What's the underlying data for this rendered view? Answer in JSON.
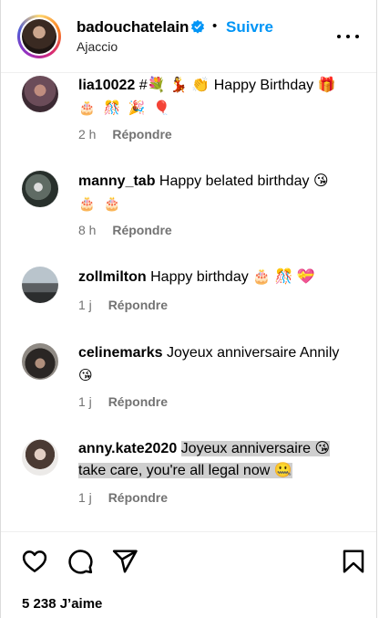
{
  "header": {
    "username": "badouchatelain",
    "follow_label": "Suivre",
    "separator": "•",
    "location": "Ajaccio",
    "verified_icon": "verified-badge-icon",
    "more_icon": "more-options-icon"
  },
  "comments": [
    {
      "username": "lia10022",
      "text": "#💐 💃 👏 Happy Birthday 🎁",
      "emoji_line": "🎂 🎊 🎉 🎈",
      "time": "2 h",
      "reply_label": "Répondre",
      "highlighted": false
    },
    {
      "username": "manny_tab",
      "text": "Happy belated birthday 😘",
      "emoji_line": "🎂 🎂",
      "time": "8 h",
      "reply_label": "Répondre",
      "highlighted": false
    },
    {
      "username": "zollmilton",
      "text": "Happy birthday 🎂 🎊 💝",
      "emoji_line": "",
      "time": "1 j",
      "reply_label": "Répondre",
      "highlighted": false
    },
    {
      "username": "celinemarks",
      "text": "Joyeux anniversaire Annily",
      "emoji_line": "😘",
      "time": "1 j",
      "reply_label": "Répondre",
      "highlighted": false
    },
    {
      "username": "anny.kate2020",
      "text": "Joyeux anniversaire 😘 take care, you're all legal now 🤐",
      "emoji_line": "",
      "time": "1 j",
      "reply_label": "Répondre",
      "highlighted": true
    }
  ],
  "actions": {
    "like_icon": "heart-icon",
    "comment_icon": "comment-icon",
    "share_icon": "share-icon",
    "save_icon": "bookmark-icon",
    "likes_text": "5 238 J’aime"
  }
}
